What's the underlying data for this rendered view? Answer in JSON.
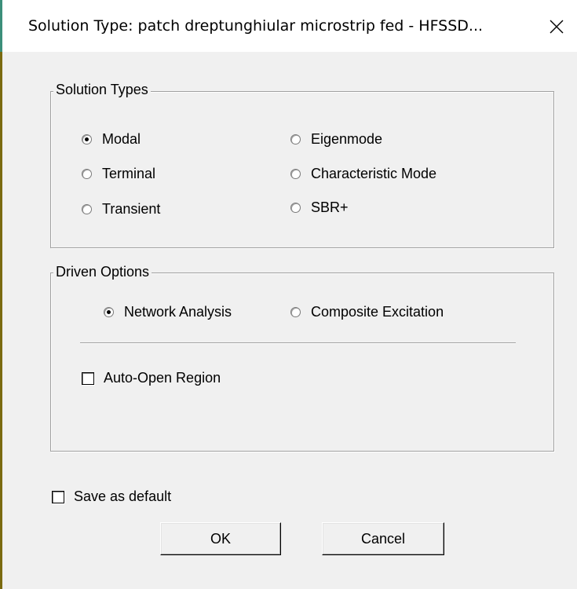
{
  "window": {
    "title": "Solution Type: patch dreptunghiular microstrip fed - HFSSD...",
    "close_icon": "close-icon"
  },
  "solution_types": {
    "legend": "Solution Types",
    "options": [
      {
        "label": "Modal",
        "checked": true
      },
      {
        "label": "Eigenmode",
        "checked": false
      },
      {
        "label": "Terminal",
        "checked": false
      },
      {
        "label": "Characteristic Mode",
        "checked": false
      },
      {
        "label": "Transient",
        "checked": false
      },
      {
        "label": "SBR+",
        "checked": false
      }
    ]
  },
  "driven_options": {
    "legend": "Driven Options",
    "options": [
      {
        "label": "Network Analysis",
        "checked": true
      },
      {
        "label": "Composite Excitation",
        "checked": false
      }
    ],
    "auto_open_region": {
      "label": "Auto-Open Region",
      "checked": false
    }
  },
  "save_as_default": {
    "label": "Save as default",
    "checked": false
  },
  "buttons": {
    "ok": "OK",
    "cancel": "Cancel"
  }
}
